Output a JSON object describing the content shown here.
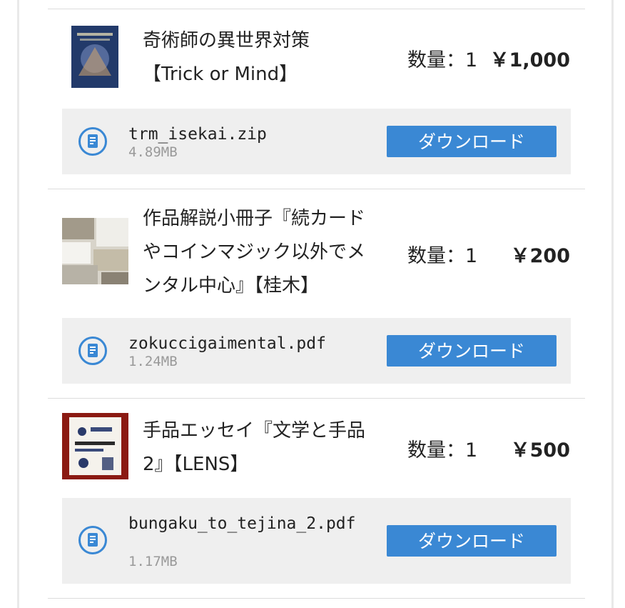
{
  "colors": {
    "accent": "#3a88d4",
    "panel": "#efefef",
    "divider": "#dcdcdc"
  },
  "items": [
    {
      "title_lines": [
        "奇術師の異世界対策",
        "【Trick or Mind】"
      ],
      "quantity": "数量：1",
      "price": "￥1,000",
      "file": {
        "name": "trm_isekai.zip",
        "size": "4.89MB",
        "icon": "file-document-icon"
      },
      "download_label": "ダウンロード"
    },
    {
      "title_lines": [
        "作品解説小冊子『続カード",
        "やコインマジック以外でメ",
        "ンタル中心』【桂木】"
      ],
      "quantity": "数量：1",
      "price": "￥200",
      "file": {
        "name": "zokuccigaimental.pdf",
        "size": "1.24MB",
        "icon": "file-document-icon"
      },
      "download_label": "ダウンロード"
    },
    {
      "title_lines": [
        "手品エッセイ『文学と手品",
        "2』【LENS】"
      ],
      "quantity": "数量：1",
      "price": "￥500",
      "file": {
        "name": "bungaku_to_tejina_2.pdf",
        "size": "1.17MB",
        "icon": "file-document-icon"
      },
      "download_label": "ダウンロード"
    }
  ]
}
